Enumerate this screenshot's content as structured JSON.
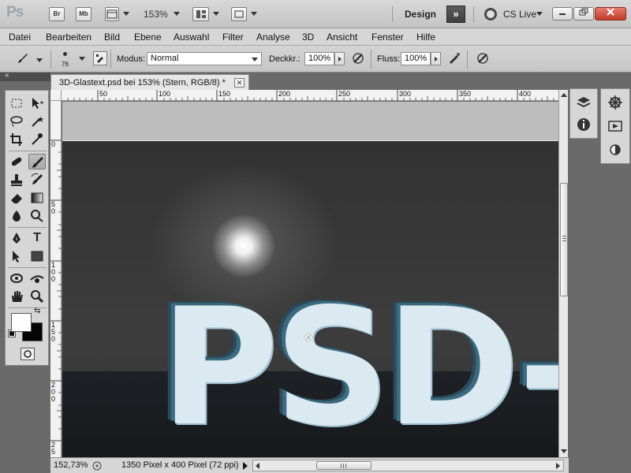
{
  "appbar": {
    "logo": "Ps",
    "bridge_label": "Br",
    "minibridge_label": "Mb",
    "zoom_level": "153%",
    "workspace": "Design",
    "cslive": "CS Live",
    "more_workspaces": "»"
  },
  "menu": [
    "Datei",
    "Bearbeiten",
    "Bild",
    "Ebene",
    "Auswahl",
    "Filter",
    "Analyse",
    "3D",
    "Ansicht",
    "Fenster",
    "Hilfe"
  ],
  "options": {
    "brush_size": "76",
    "mode_label": "Modus:",
    "mode_value": "Normal",
    "opacity_label": "Deckkr.:",
    "opacity_value": "100%",
    "flow_label": "Fluss:",
    "flow_value": "100%"
  },
  "document": {
    "tab_title": "3D-Glastext.psd bei 153% (Stern, RGB/8) *",
    "close_glyph": "✕",
    "image_text": "PSD-"
  },
  "ruler": {
    "top_ticks": [
      "50",
      "100",
      "150",
      "200",
      "250",
      "300",
      "350",
      "400"
    ],
    "left_ticks": [
      "0",
      "5\n0",
      "1\n0\n0",
      "1\n5\n0",
      "2\n0\n0",
      "2\n5"
    ]
  },
  "status": {
    "zoom": "152,73%",
    "info": "1350 Pixel x 400 Pixel (72 ppi)"
  },
  "colors": {
    "accent_dark": "#3e3e3e",
    "close_red": "#c23a28",
    "glass_text": "#dbe9f0"
  }
}
